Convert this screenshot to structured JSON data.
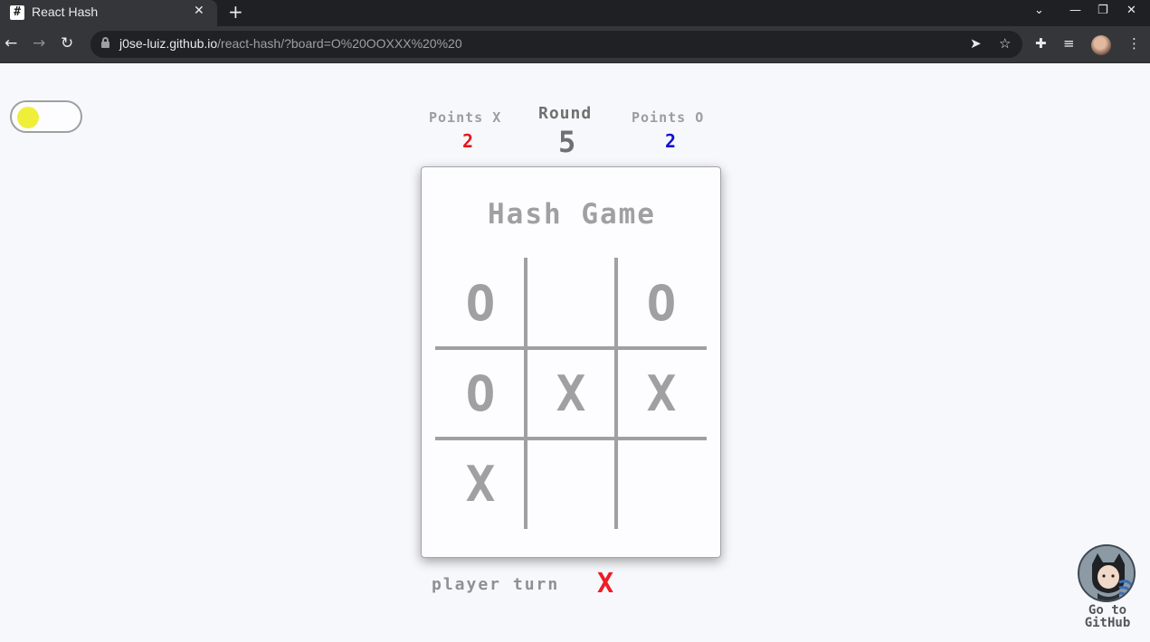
{
  "browser": {
    "tab_title": "React Hash",
    "favicon": "#",
    "url_host": "j0se-luiz.github.io",
    "url_path": "/react-hash/?board=O%20OOXXX%20%20"
  },
  "scoreboard": {
    "points_x_label": "Points X",
    "points_x": "2",
    "round_label": "Round",
    "round": "5",
    "points_o_label": "Points O",
    "points_o": "2"
  },
  "game": {
    "title": "Hash Game",
    "board": [
      "O",
      "",
      "O",
      "O",
      "X",
      "X",
      "X",
      "",
      ""
    ]
  },
  "turn": {
    "label": "player turn",
    "player": "X"
  },
  "github": {
    "label": "Go to GitHub"
  },
  "colors": {
    "x_score": "#e01a1a",
    "o_score": "#1010d0",
    "round": "#707070",
    "toggle_knob": "#efef3a",
    "piece": "#a09fa2",
    "turn_mark": "#ee1c24"
  }
}
